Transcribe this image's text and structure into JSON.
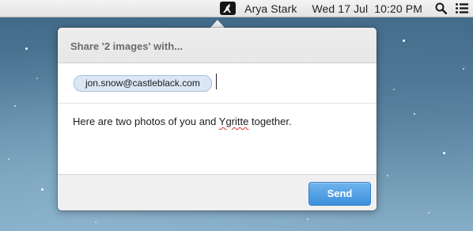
{
  "menubar": {
    "app_icon": "kangaroo-app-icon",
    "user_name": "Arya Stark",
    "date": "Wed 17 Jul",
    "time": "10:20 PM",
    "search_icon": "magnifier-icon",
    "notification_icon": "list-bullets-icon"
  },
  "share_panel": {
    "title": "Share '2 images' with...",
    "recipients": [
      "jon.snow@castleblack.com"
    ],
    "message_before": "Here are two photos of you and ",
    "message_misspelled": "Ygritte",
    "message_after": " together.",
    "send_label": "Send"
  },
  "colors": {
    "send_button": "#4a9be3",
    "recipient_token": "#dce7f6",
    "spellcheck_underline": "#e0302a",
    "menubar": "#ececec"
  }
}
